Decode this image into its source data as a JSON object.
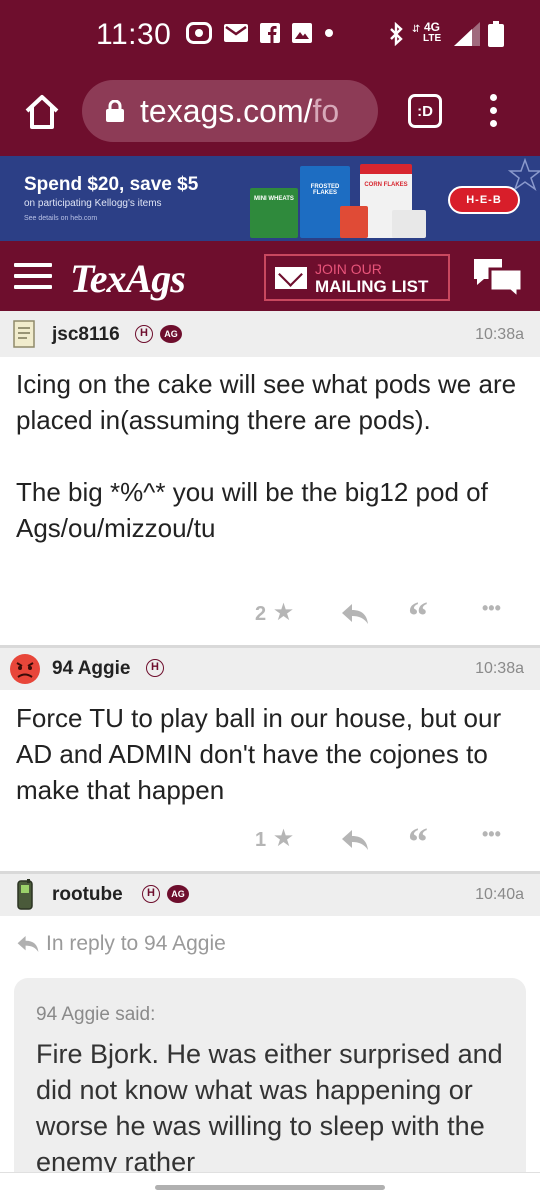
{
  "status_bar": {
    "time": "11:30",
    "network_label_top": "4G",
    "network_label_bottom": "LTE"
  },
  "browser": {
    "url_main": "texags.com/",
    "url_faded": "fo",
    "tab_label": ":D"
  },
  "ad": {
    "headline": "Spend $20, save $5",
    "subline": "on participating Kellogg's items",
    "fineprint": "See details on heb.com",
    "box_labels": [
      "MINI WHEATS",
      "FROSTED FLAKES",
      "CORN FLAKES"
    ],
    "brand": "H-E-B"
  },
  "site_header": {
    "logo": "TexAgs",
    "mailing_line1": "JOIN OUR",
    "mailing_line2": "MAILING LIST"
  },
  "posts": [
    {
      "username": "jsc8116",
      "badge_h": "H",
      "badge_ag": "AG",
      "time": "10:38a",
      "body_p1": "Icing on the cake will see what pods we are placed in(assuming there are pods).",
      "body_p2": "The big *%^* you will be the big12 pod of Ags/ou/mizzou/tu",
      "stars": "2"
    },
    {
      "username": "94 Aggie",
      "badge_h": "H",
      "time": "10:38a",
      "body_p1": "Force TU to play ball in our house, but our AD and ADMIN don't have the cojones to make that happen",
      "stars": "1"
    },
    {
      "username": "rootube",
      "badge_h": "H",
      "badge_ag": "AG",
      "time": "10:40a",
      "reply_to": "In reply to 94 Aggie",
      "quote_said": "94 Aggie said:",
      "quote_text": "Fire Bjork. He was either surprised and did not know what was happening or worse he was willing to sleep with the enemy rather"
    }
  ],
  "icons": {
    "quote_symbol": "“",
    "more_symbol": "•••"
  },
  "colors": {
    "maroon": "#6e0e2d",
    "url_pill": "#8d3b56",
    "ad_blue": "#2c3f86",
    "heb_red": "#d81e2a",
    "post_header_bg": "#eeeeee",
    "action_gray": "#b5b5b5"
  }
}
